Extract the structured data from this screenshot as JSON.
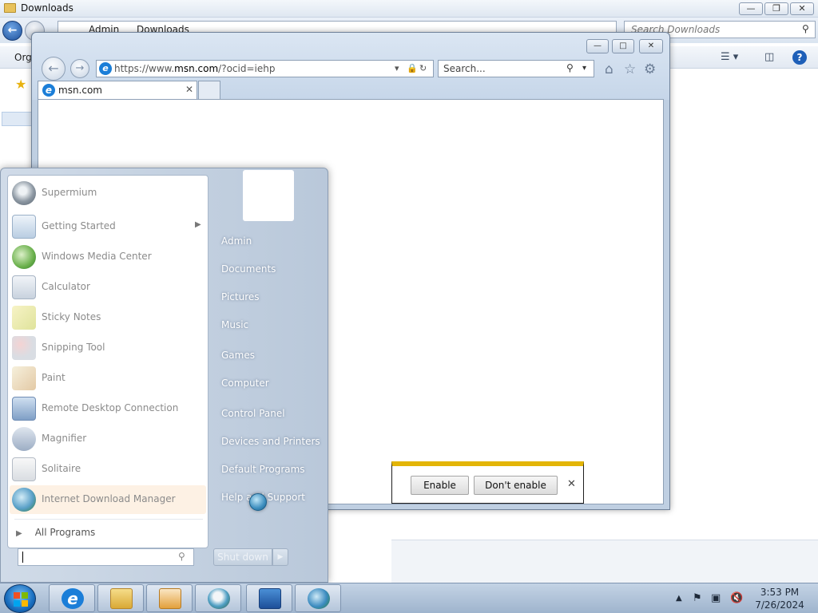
{
  "explorer": {
    "title": "Downloads",
    "breadcrumb": [
      "Admin",
      "Downloads"
    ],
    "search_placeholder": "Search Downloads",
    "toolbar_label": "Org"
  },
  "ie": {
    "url_prefix": "https://www.",
    "url_domain": "msn.com",
    "url_rest": "/?ocid=iehp",
    "search_placeholder": "Search...",
    "tab_title": "msn.com"
  },
  "notification": {
    "enable_label": "Enable",
    "dont_enable_label": "Don't enable"
  },
  "start_menu": {
    "programs": [
      {
        "label": "Supermium",
        "icon": "supermium-icon",
        "has_submenu": false
      },
      {
        "label": "Getting Started",
        "icon": "getting-started-icon",
        "has_submenu": true
      },
      {
        "label": "Windows Media Center",
        "icon": "media-center-icon",
        "has_submenu": false
      },
      {
        "label": "Calculator",
        "icon": "calculator-icon",
        "has_submenu": false
      },
      {
        "label": "Sticky Notes",
        "icon": "sticky-notes-icon",
        "has_submenu": false
      },
      {
        "label": "Snipping Tool",
        "icon": "snipping-tool-icon",
        "has_submenu": false
      },
      {
        "label": "Paint",
        "icon": "paint-icon",
        "has_submenu": false
      },
      {
        "label": "Remote Desktop Connection",
        "icon": "remote-desktop-icon",
        "has_submenu": false
      },
      {
        "label": "Magnifier",
        "icon": "magnifier-icon",
        "has_submenu": false
      },
      {
        "label": "Solitaire",
        "icon": "solitaire-icon",
        "has_submenu": false
      },
      {
        "label": "Internet Download Manager",
        "icon": "idm-icon",
        "has_submenu": false
      }
    ],
    "all_programs_label": "All Programs",
    "right_links": [
      "Admin",
      "Documents",
      "Pictures",
      "Music",
      "Games",
      "Computer",
      "Control Panel",
      "Devices and Printers",
      "Default Programs",
      "Help and Support"
    ],
    "shutdown_label": "Shut down"
  },
  "taskbar": {
    "apps": [
      "internet-explorer-icon",
      "windows-explorer-icon",
      "media-player-icon",
      "supermium-icon",
      "store-icon",
      "idm-icon"
    ],
    "clock_time": "3:53 PM",
    "clock_date": "7/26/2024"
  },
  "colors": {
    "notification_accent": "#e3b507",
    "start_menu_bg": "#c4d2e3",
    "taskbar_bg": "#b2c4da"
  }
}
